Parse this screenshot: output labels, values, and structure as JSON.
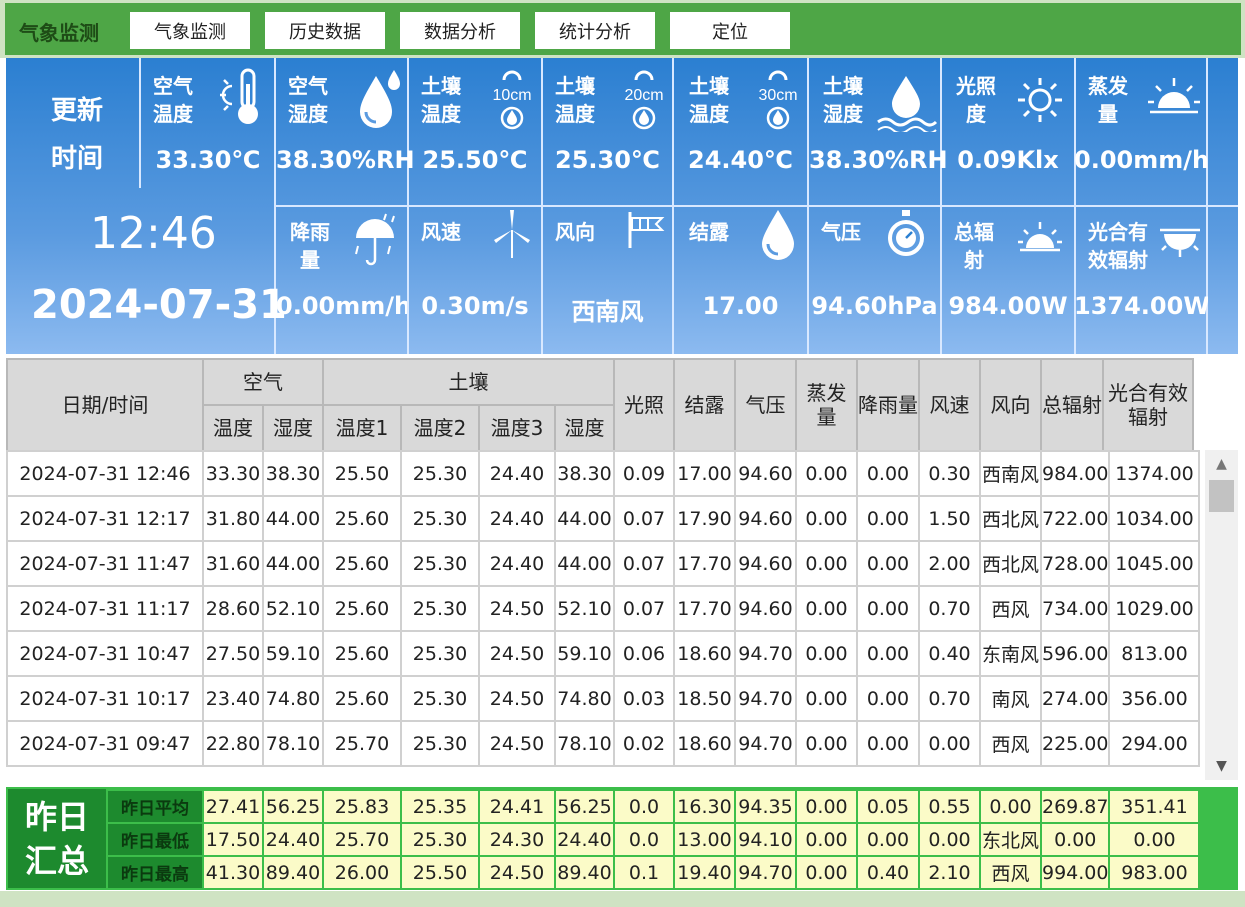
{
  "app_title": "气象监测",
  "nav": [
    "气象监测",
    "历史数据",
    "数据分析",
    "统计分析",
    "定位"
  ],
  "update_label_1": "更新",
  "update_label_2": "时间",
  "update_time": "12:46",
  "update_date": "2024-07-31",
  "sensors_row1": [
    {
      "label": [
        "空气",
        "温度"
      ],
      "icon": "thermometer-icon",
      "value": "33.30℃"
    },
    {
      "label": [
        "空气",
        "湿度"
      ],
      "icon": "water-drop-icon",
      "value": "38.30%RH"
    },
    {
      "label": [
        "土壤",
        "温度"
      ],
      "icon": "soil-10cm-icon",
      "depth": "10cm",
      "value": "25.50℃"
    },
    {
      "label": [
        "土壤",
        "温度"
      ],
      "icon": "soil-20cm-icon",
      "depth": "20cm",
      "value": "25.30℃"
    },
    {
      "label": [
        "土壤",
        "温度"
      ],
      "icon": "soil-30cm-icon",
      "depth": "30cm",
      "value": "24.40℃"
    },
    {
      "label": [
        "土壤",
        "湿度"
      ],
      "icon": "soil-moisture-icon",
      "value": "38.30%RH"
    },
    {
      "label": [
        "光照",
        "度"
      ],
      "icon": "sun-icon",
      "value": "0.09Klx"
    },
    {
      "label": [
        "蒸发",
        "量"
      ],
      "icon": "sunrise-icon",
      "value": "0.00mm/h"
    }
  ],
  "sensors_row2": [
    {
      "label": [
        "降雨",
        "量"
      ],
      "icon": "rain-umbrella-icon",
      "value": "0.00mm/h"
    },
    {
      "label": [
        "风速"
      ],
      "icon": "wind-turbine-icon",
      "value": "0.30m/s"
    },
    {
      "label": [
        "风向"
      ],
      "icon": "wind-vane-icon",
      "value": "西南风"
    },
    {
      "label": [
        "结露"
      ],
      "icon": "dew-drop-icon",
      "value": "17.00"
    },
    {
      "label": [
        "气压"
      ],
      "icon": "stopwatch-icon",
      "value": "94.60hPa"
    },
    {
      "label": [
        "总辐",
        "射"
      ],
      "icon": "radiation-icon",
      "value": "984.00W"
    },
    {
      "label": [
        "光合有",
        "效辐射"
      ],
      "icon": "par-radiation-icon",
      "value": "1374.00W"
    }
  ],
  "table": {
    "header_top": {
      "datetime": "日期/时间",
      "air": "空气",
      "soil": "土壤",
      "light": "光照",
      "dew": "结露",
      "pressure": "气压",
      "evap": "蒸发量",
      "rain": "降雨量",
      "windspeed": "风速",
      "winddir": "风向",
      "total_rad": "总辐射",
      "par": "光合有效辐射"
    },
    "header_sub": [
      "温度",
      "湿度",
      "温度1",
      "温度2",
      "温度3",
      "湿度"
    ],
    "rows": [
      [
        "2024-07-31 12:46",
        "33.30",
        "38.30",
        "25.50",
        "25.30",
        "24.40",
        "38.30",
        "0.09",
        "17.00",
        "94.60",
        "0.00",
        "0.00",
        "0.30",
        "西南风",
        "984.00",
        "1374.00"
      ],
      [
        "2024-07-31 12:17",
        "31.80",
        "44.00",
        "25.60",
        "25.30",
        "24.40",
        "44.00",
        "0.07",
        "17.90",
        "94.60",
        "0.00",
        "0.00",
        "1.50",
        "西北风",
        "722.00",
        "1034.00"
      ],
      [
        "2024-07-31 11:47",
        "31.60",
        "44.00",
        "25.60",
        "25.30",
        "24.40",
        "44.00",
        "0.07",
        "17.70",
        "94.60",
        "0.00",
        "0.00",
        "2.00",
        "西北风",
        "728.00",
        "1045.00"
      ],
      [
        "2024-07-31 11:17",
        "28.60",
        "52.10",
        "25.60",
        "25.30",
        "24.50",
        "52.10",
        "0.07",
        "17.70",
        "94.60",
        "0.00",
        "0.00",
        "0.70",
        "西风",
        "734.00",
        "1029.00"
      ],
      [
        "2024-07-31 10:47",
        "27.50",
        "59.10",
        "25.60",
        "25.30",
        "24.50",
        "59.10",
        "0.06",
        "18.60",
        "94.70",
        "0.00",
        "0.00",
        "0.40",
        "东南风",
        "596.00",
        "813.00"
      ],
      [
        "2024-07-31 10:17",
        "23.40",
        "74.80",
        "25.60",
        "25.30",
        "24.50",
        "74.80",
        "0.03",
        "18.50",
        "94.70",
        "0.00",
        "0.00",
        "0.70",
        "南风",
        "274.00",
        "356.00"
      ],
      [
        "2024-07-31 09:47",
        "22.80",
        "78.10",
        "25.70",
        "25.30",
        "24.50",
        "78.10",
        "0.02",
        "18.60",
        "94.70",
        "0.00",
        "0.00",
        "0.00",
        "西风",
        "225.00",
        "294.00"
      ]
    ]
  },
  "summary": {
    "title_1": "昨日",
    "title_2": "汇总",
    "rows": [
      {
        "label": "昨日平均",
        "values": [
          "27.41",
          "56.25",
          "25.83",
          "25.35",
          "24.41",
          "56.25",
          "0.0",
          "16.30",
          "94.35",
          "0.00",
          "0.05",
          "0.55",
          "0.00",
          "269.87",
          "351.41"
        ]
      },
      {
        "label": "昨日最低",
        "values": [
          "17.50",
          "24.40",
          "25.70",
          "25.30",
          "24.30",
          "24.40",
          "0.0",
          "13.00",
          "94.10",
          "0.00",
          "0.00",
          "0.00",
          "东北风",
          "0.00",
          "0.00"
        ]
      },
      {
        "label": "昨日最高",
        "values": [
          "41.30",
          "89.40",
          "26.00",
          "25.50",
          "24.50",
          "89.40",
          "0.1",
          "19.40",
          "94.70",
          "0.00",
          "0.40",
          "2.10",
          "西风",
          "994.00",
          "983.00"
        ]
      }
    ]
  },
  "colors": {
    "green_bar": "#4ea646",
    "green_summary": "#3cbe4a",
    "green_dark": "#1d8a2e",
    "blue_panel": "#2b7fd1",
    "summary_cell": "#fbfbc8"
  }
}
